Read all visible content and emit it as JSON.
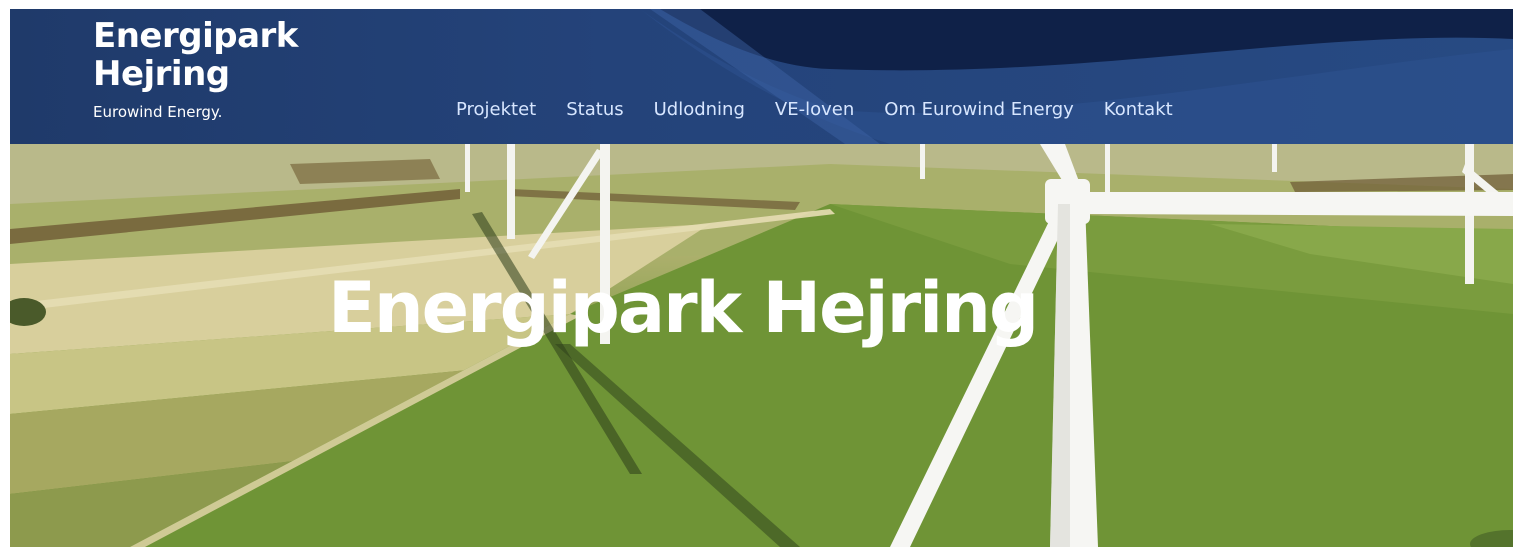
{
  "logo": {
    "line1": "Energipark",
    "line2": "Hejring",
    "subtitle": "Eurowind Energy."
  },
  "nav": {
    "items": [
      {
        "label": "Projektet"
      },
      {
        "label": "Status"
      },
      {
        "label": "Udlodning"
      },
      {
        "label": "VE-loven"
      },
      {
        "label": "Om Eurowind Energy"
      },
      {
        "label": "Kontakt"
      }
    ]
  },
  "hero": {
    "title": "Energipark Hejring"
  },
  "colors": {
    "header_bg": "#24437a",
    "header_dark_wave": "#0f2148",
    "nav_text": "#d7e6ff",
    "field_green": "#6b8f35",
    "field_light": "#cfc49a"
  }
}
